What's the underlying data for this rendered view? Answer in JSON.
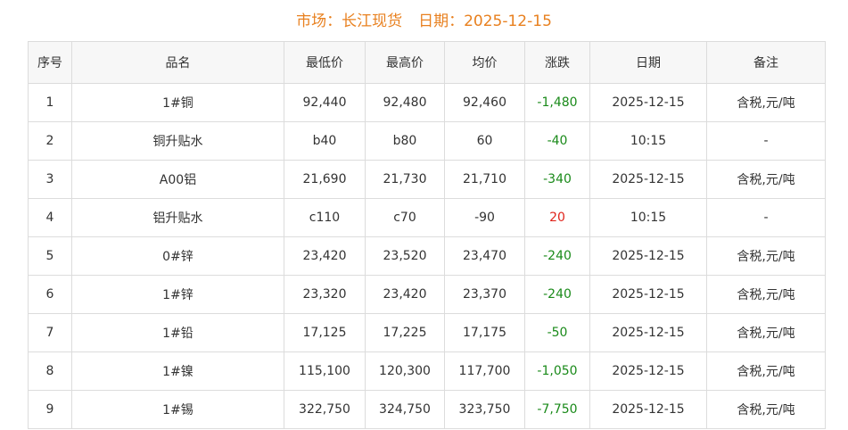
{
  "header": {
    "market_label": "市场：长江现货",
    "date_label": "日期：2025-12-15"
  },
  "table": {
    "columns": [
      "序号",
      "品名",
      "最低价",
      "最高价",
      "均价",
      "涨跌",
      "日期",
      "备注"
    ],
    "rows": [
      {
        "idx": "1",
        "name": "1#铜",
        "low": "92,440",
        "high": "92,480",
        "avg": "92,460",
        "change": "-1,480",
        "trend": "down",
        "date": "2025-12-15",
        "note": "含税,元/吨"
      },
      {
        "idx": "2",
        "name": "铜升贴水",
        "low": "b40",
        "high": "b80",
        "avg": "60",
        "change": "-40",
        "trend": "down",
        "date": "10:15",
        "note": "-"
      },
      {
        "idx": "3",
        "name": "A00铝",
        "low": "21,690",
        "high": "21,730",
        "avg": "21,710",
        "change": "-340",
        "trend": "down",
        "date": "2025-12-15",
        "note": "含税,元/吨"
      },
      {
        "idx": "4",
        "name": "铝升贴水",
        "low": "c110",
        "high": "c70",
        "avg": "-90",
        "change": "20",
        "trend": "up",
        "date": "10:15",
        "note": "-"
      },
      {
        "idx": "5",
        "name": "0#锌",
        "low": "23,420",
        "high": "23,520",
        "avg": "23,470",
        "change": "-240",
        "trend": "down",
        "date": "2025-12-15",
        "note": "含税,元/吨"
      },
      {
        "idx": "6",
        "name": "1#锌",
        "low": "23,320",
        "high": "23,420",
        "avg": "23,370",
        "change": "-240",
        "trend": "down",
        "date": "2025-12-15",
        "note": "含税,元/吨"
      },
      {
        "idx": "7",
        "name": "1#铅",
        "low": "17,125",
        "high": "17,225",
        "avg": "17,175",
        "change": "-50",
        "trend": "down",
        "date": "2025-12-15",
        "note": "含税,元/吨"
      },
      {
        "idx": "8",
        "name": "1#镍",
        "low": "115,100",
        "high": "120,300",
        "avg": "117,700",
        "change": "-1,050",
        "trend": "down",
        "date": "2025-12-15",
        "note": "含税,元/吨"
      },
      {
        "idx": "9",
        "name": "1#锡",
        "low": "322,750",
        "high": "324,750",
        "avg": "323,750",
        "change": "-7,750",
        "trend": "down",
        "date": "2025-12-15",
        "note": "含税,元/吨"
      }
    ]
  },
  "colors": {
    "title": "#e8801f",
    "down": "#1a8a1a",
    "up": "#e0241b"
  }
}
